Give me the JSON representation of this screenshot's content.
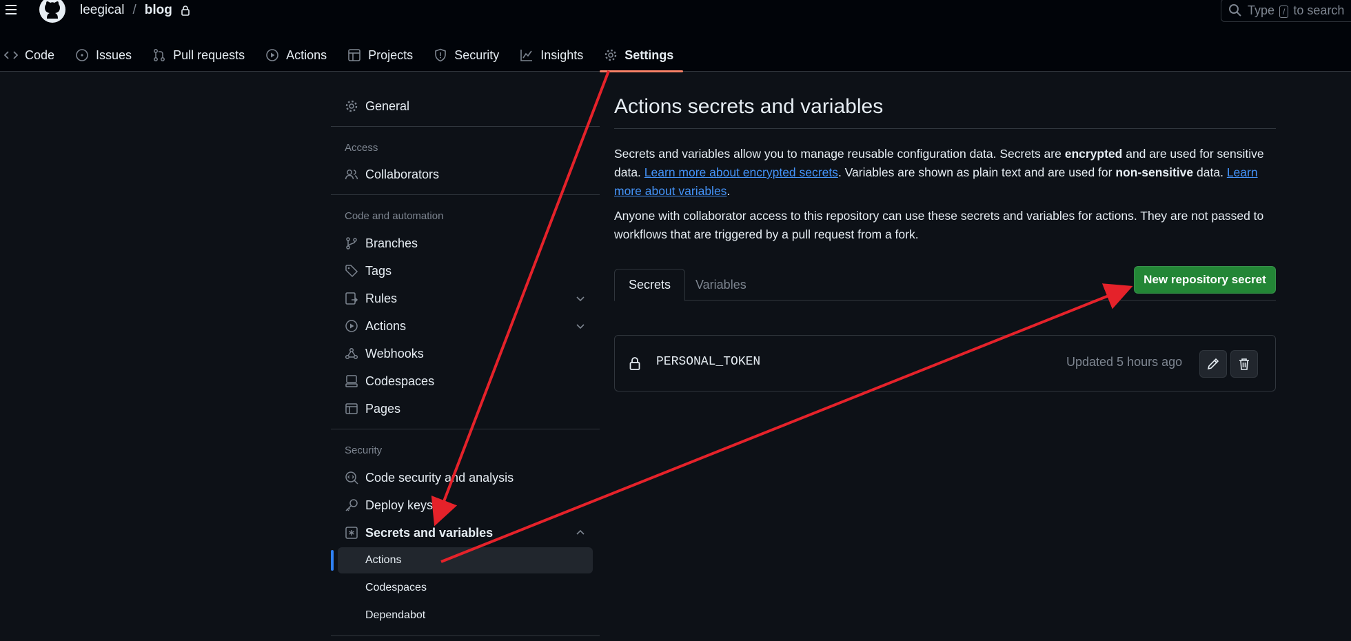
{
  "header": {
    "owner": "leegical",
    "separator": "/",
    "repo": "blog",
    "search": {
      "prefix": "Type",
      "key": "/",
      "suffix": "to search"
    }
  },
  "nav": {
    "tabs": [
      {
        "label": "Code",
        "icon": "code-icon"
      },
      {
        "label": "Issues",
        "icon": "issue-icon"
      },
      {
        "label": "Pull requests",
        "icon": "pull-request-icon"
      },
      {
        "label": "Actions",
        "icon": "play-icon"
      },
      {
        "label": "Projects",
        "icon": "table-icon"
      },
      {
        "label": "Security",
        "icon": "shield-icon"
      },
      {
        "label": "Insights",
        "icon": "graph-icon"
      },
      {
        "label": "Settings",
        "icon": "gear-icon",
        "active": true
      }
    ]
  },
  "sidebar": {
    "general": "General",
    "access_heading": "Access",
    "collaborators": "Collaborators",
    "code_heading": "Code and automation",
    "branches": "Branches",
    "tags": "Tags",
    "rules": "Rules",
    "actions": "Actions",
    "webhooks": "Webhooks",
    "codespaces": "Codespaces",
    "pages": "Pages",
    "security_heading": "Security",
    "code_security": "Code security and analysis",
    "deploy_keys": "Deploy keys",
    "secrets": "Secrets and variables",
    "sub": {
      "actions": "Actions",
      "codespaces": "Codespaces",
      "dependabot": "Dependabot"
    }
  },
  "main": {
    "title": "Actions secrets and variables",
    "p1": {
      "t1": "Secrets and variables allow you to manage reusable configuration data. Secrets are ",
      "b1": "encrypted",
      "t2": " and are used for sensitive data. ",
      "link1": "Learn more about encrypted secrets",
      "t3": ". Variables are shown as plain text and are used for ",
      "b2": "non-sensitive",
      "t4": " data. ",
      "link2": "Learn more about variables",
      "t5": "."
    },
    "p2": "Anyone with collaborator access to this repository can use these secrets and variables for actions. They are not passed to workflows that are triggered by a pull request from a fork.",
    "tabs": {
      "secrets": "Secrets",
      "variables": "Variables"
    },
    "new_secret_button": "New repository secret",
    "secret": {
      "name": "PERSONAL_TOKEN",
      "updated": "Updated 5 hours ago"
    }
  },
  "colors": {
    "background": "#0d1117",
    "header": "#010409",
    "accent_tab": "#f78166",
    "link": "#4493f8",
    "primary_button": "#238636",
    "annotation_arrow": "#e5222a"
  }
}
